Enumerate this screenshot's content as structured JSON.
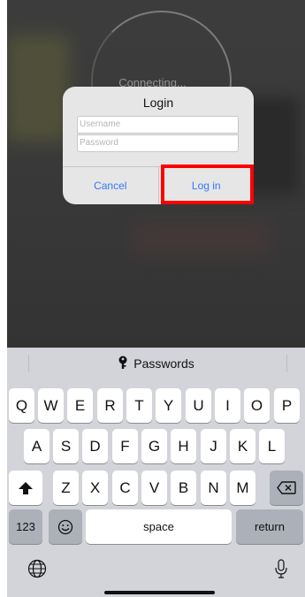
{
  "background": {
    "status_text": "Connecting..."
  },
  "dialog": {
    "title": "Login",
    "username_placeholder": "Username",
    "password_placeholder": "Password",
    "cancel_label": "Cancel",
    "login_label": "Log in"
  },
  "keyboard": {
    "suggestion": "Passwords",
    "row1": [
      "Q",
      "W",
      "E",
      "R",
      "T",
      "Y",
      "U",
      "I",
      "O",
      "P"
    ],
    "row2": [
      "A",
      "S",
      "D",
      "F",
      "G",
      "H",
      "J",
      "K",
      "L"
    ],
    "row3": [
      "Z",
      "X",
      "C",
      "V",
      "B",
      "N",
      "M"
    ],
    "numbers_label": "123",
    "space_label": "space",
    "return_label": "return"
  },
  "colors": {
    "accent": "#3478f6",
    "highlight": "#ff0000"
  }
}
